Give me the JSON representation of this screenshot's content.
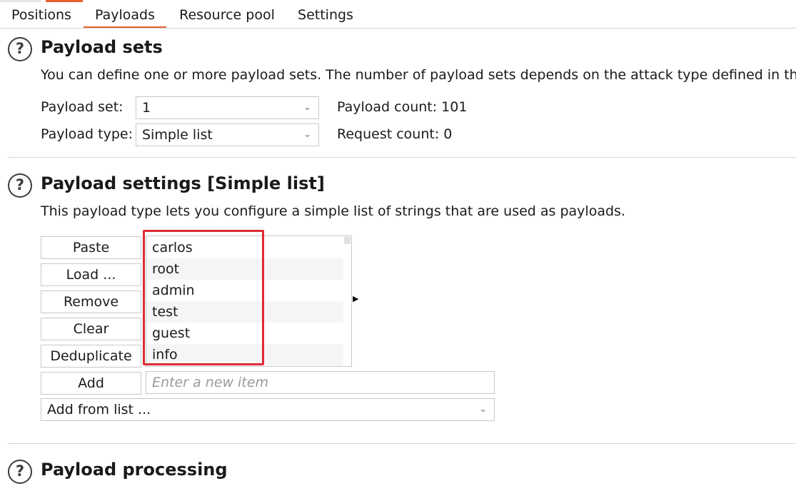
{
  "tabs": [
    {
      "label": "Positions"
    },
    {
      "label": "Payloads"
    },
    {
      "label": "Resource pool"
    },
    {
      "label": "Settings"
    }
  ],
  "payload_sets": {
    "help_icon": "question-mark",
    "title": "Payload sets",
    "description": "You can define one or more payload sets. The number of payload sets depends on the attack type defined in th",
    "set_label": "Payload set:",
    "set_value": "1",
    "type_label": "Payload type:",
    "type_value": "Simple list",
    "payload_count": "Payload count: 101",
    "request_count": "Request count: 0"
  },
  "payload_settings": {
    "help_icon": "question-mark",
    "title": "Payload settings [Simple list]",
    "description": "This payload type lets you configure a simple list of strings that are used as payloads.",
    "buttons": {
      "paste": "Paste",
      "load": "Load ...",
      "remove": "Remove",
      "clear": "Clear",
      "deduplicate": "Deduplicate",
      "add": "Add"
    },
    "items": [
      "carlos",
      "root",
      "admin",
      "test",
      "guest",
      "info"
    ],
    "new_item_placeholder": "Enter a new item",
    "add_from_list": "Add from list ..."
  },
  "payload_processing": {
    "help_icon": "question-mark",
    "title": "Payload processing"
  },
  "colors": {
    "accent": "#e8612c",
    "highlight": "#e02a35"
  }
}
